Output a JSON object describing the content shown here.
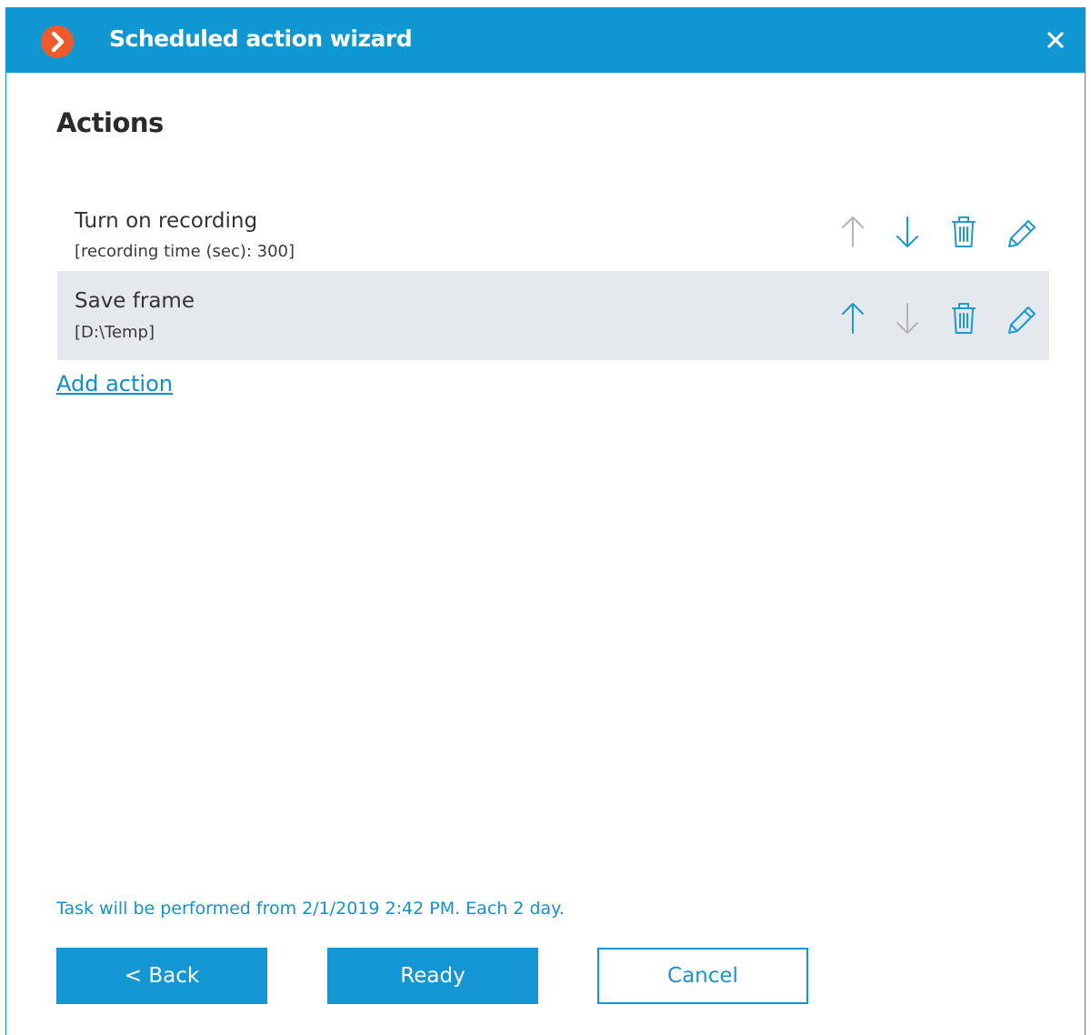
{
  "window": {
    "title": "Scheduled action wizard",
    "logo_icon": "chevron-right-logo",
    "close_icon": "close-icon"
  },
  "page": {
    "heading": "Actions"
  },
  "actions": [
    {
      "name": "Turn on recording",
      "params": "[recording time (sec): 300]",
      "selected": false,
      "up_enabled": false,
      "down_enabled": true
    },
    {
      "name": "Save frame",
      "params": "[D:\\Temp]",
      "selected": true,
      "up_enabled": true,
      "down_enabled": false
    }
  ],
  "add_action_label": "Add action",
  "status_text": "Task will be performed from 2/1/2019 2:42 PM. Each 2 day.",
  "buttons": {
    "back": "< Back",
    "ready": "Ready",
    "cancel": "Cancel"
  },
  "colors": {
    "accent": "#1496d4",
    "titlebar": "#0f97d4",
    "logo": "#f05a28",
    "selected_row": "#e5e8ed",
    "icon_enabled": "#1a9ad6",
    "icon_disabled": "#b4b4b4"
  }
}
